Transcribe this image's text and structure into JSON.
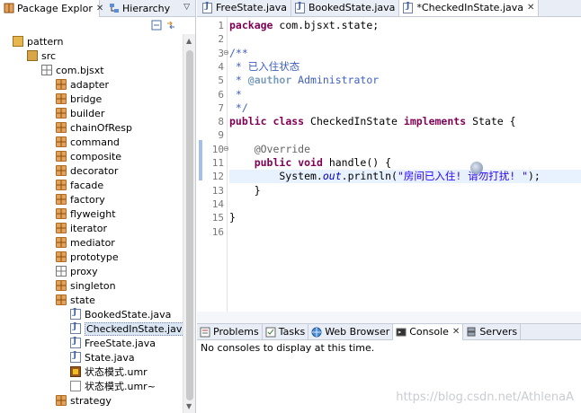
{
  "left_tabs": [
    {
      "label": "Package Explor",
      "closable": true
    },
    {
      "label": "Hierarchy",
      "closable": false
    }
  ],
  "tree": [
    {
      "label": "pattern",
      "indent": 0,
      "icon": "project-icon"
    },
    {
      "label": "src",
      "indent": 1,
      "icon": "source-folder-icon"
    },
    {
      "label": "com.bjsxt",
      "indent": 2,
      "icon": "package-empty-icon"
    },
    {
      "label": "adapter",
      "indent": 3,
      "icon": "package-icon"
    },
    {
      "label": "bridge",
      "indent": 3,
      "icon": "package-icon"
    },
    {
      "label": "builder",
      "indent": 3,
      "icon": "package-icon"
    },
    {
      "label": "chainOfResp",
      "indent": 3,
      "icon": "package-icon"
    },
    {
      "label": "command",
      "indent": 3,
      "icon": "package-icon"
    },
    {
      "label": "composite",
      "indent": 3,
      "icon": "package-icon"
    },
    {
      "label": "decorator",
      "indent": 3,
      "icon": "package-icon"
    },
    {
      "label": "facade",
      "indent": 3,
      "icon": "package-icon"
    },
    {
      "label": "factory",
      "indent": 3,
      "icon": "package-icon"
    },
    {
      "label": "flyweight",
      "indent": 3,
      "icon": "package-icon"
    },
    {
      "label": "iterator",
      "indent": 3,
      "icon": "package-icon"
    },
    {
      "label": "mediator",
      "indent": 3,
      "icon": "package-icon"
    },
    {
      "label": "prototype",
      "indent": 3,
      "icon": "package-icon"
    },
    {
      "label": "proxy",
      "indent": 3,
      "icon": "package-empty-icon"
    },
    {
      "label": "singleton",
      "indent": 3,
      "icon": "package-icon"
    },
    {
      "label": "state",
      "indent": 3,
      "icon": "package-icon"
    },
    {
      "label": "BookedState.java",
      "indent": 4,
      "icon": "java-file-icon"
    },
    {
      "label": "CheckedInState.java",
      "indent": 4,
      "icon": "java-file-icon",
      "selected": true
    },
    {
      "label": "FreeState.java",
      "indent": 4,
      "icon": "java-file-icon"
    },
    {
      "label": "State.java",
      "indent": 4,
      "icon": "java-file-icon"
    },
    {
      "label": "状态模式.umr",
      "indent": 4,
      "icon": "umr-file-icon"
    },
    {
      "label": "状态模式.umr~",
      "indent": 4,
      "icon": "generic-file-icon"
    },
    {
      "label": "strategy",
      "indent": 3,
      "icon": "package-icon"
    }
  ],
  "editor_tabs": [
    {
      "label": "FreeState.java",
      "active": false
    },
    {
      "label": "BookedState.java",
      "active": false
    },
    {
      "label": "*CheckedInState.java",
      "active": true,
      "closable": true
    }
  ],
  "code_lines": [
    {
      "n": "1",
      "tokens": [
        [
          "kw",
          "package"
        ],
        [
          "",
          " com.bjsxt.state;"
        ]
      ]
    },
    {
      "n": "2",
      "tokens": []
    },
    {
      "n": "3",
      "tokens": [
        [
          "cm",
          "/**"
        ]
      ],
      "fold": "⊖"
    },
    {
      "n": "4",
      "tokens": [
        [
          "cm",
          " * 已入住状态"
        ]
      ]
    },
    {
      "n": "5",
      "tokens": [
        [
          "cm",
          " * "
        ],
        [
          "tg",
          "@author"
        ],
        [
          "cm",
          " Administrator"
        ]
      ]
    },
    {
      "n": "6",
      "tokens": [
        [
          "cm",
          " *"
        ]
      ]
    },
    {
      "n": "7",
      "tokens": [
        [
          "cm",
          " */"
        ]
      ]
    },
    {
      "n": "8",
      "tokens": [
        [
          "kw",
          "public"
        ],
        [
          "",
          " "
        ],
        [
          "kw",
          "class"
        ],
        [
          "",
          " CheckedInState "
        ],
        [
          "kw",
          "implements"
        ],
        [
          "",
          " State {"
        ]
      ]
    },
    {
      "n": "9",
      "tokens": []
    },
    {
      "n": "10",
      "tokens": [
        [
          "",
          "    "
        ],
        [
          "an",
          "@Override"
        ]
      ],
      "fold": "⊖",
      "marker": true
    },
    {
      "n": "11",
      "tokens": [
        [
          "",
          "    "
        ],
        [
          "kw",
          "public"
        ],
        [
          "",
          " "
        ],
        [
          "kw",
          "void"
        ],
        [
          "",
          " handle() {"
        ]
      ],
      "marker": true
    },
    {
      "n": "12",
      "tokens": [
        [
          "",
          "        System."
        ],
        [
          "it",
          "out"
        ],
        [
          "",
          ".println("
        ],
        [
          "st",
          "\"房间已入住! 请勿打扰! \""
        ],
        [
          "",
          ");"
        ]
      ],
      "marker": true,
      "current": true
    },
    {
      "n": "13",
      "tokens": [
        [
          "",
          "    }"
        ]
      ]
    },
    {
      "n": "14",
      "tokens": []
    },
    {
      "n": "15",
      "tokens": [
        [
          "",
          "}"
        ]
      ]
    },
    {
      "n": "16",
      "tokens": []
    }
  ],
  "bottom_tabs": [
    {
      "label": "Problems",
      "icon": "problems-icon",
      "active": false
    },
    {
      "label": "Tasks",
      "icon": "tasks-icon",
      "active": false
    },
    {
      "label": "Web Browser",
      "icon": "globe-icon",
      "active": false
    },
    {
      "label": "Console",
      "icon": "console-icon",
      "active": true,
      "closable": true
    },
    {
      "label": "Servers",
      "icon": "servers-icon",
      "active": false
    }
  ],
  "console": {
    "message": "No consoles to display at this time."
  },
  "watermark": "https://blog.csdn.net/AthlenaA",
  "close_glyph": "✕",
  "menu_glyph": "▽"
}
